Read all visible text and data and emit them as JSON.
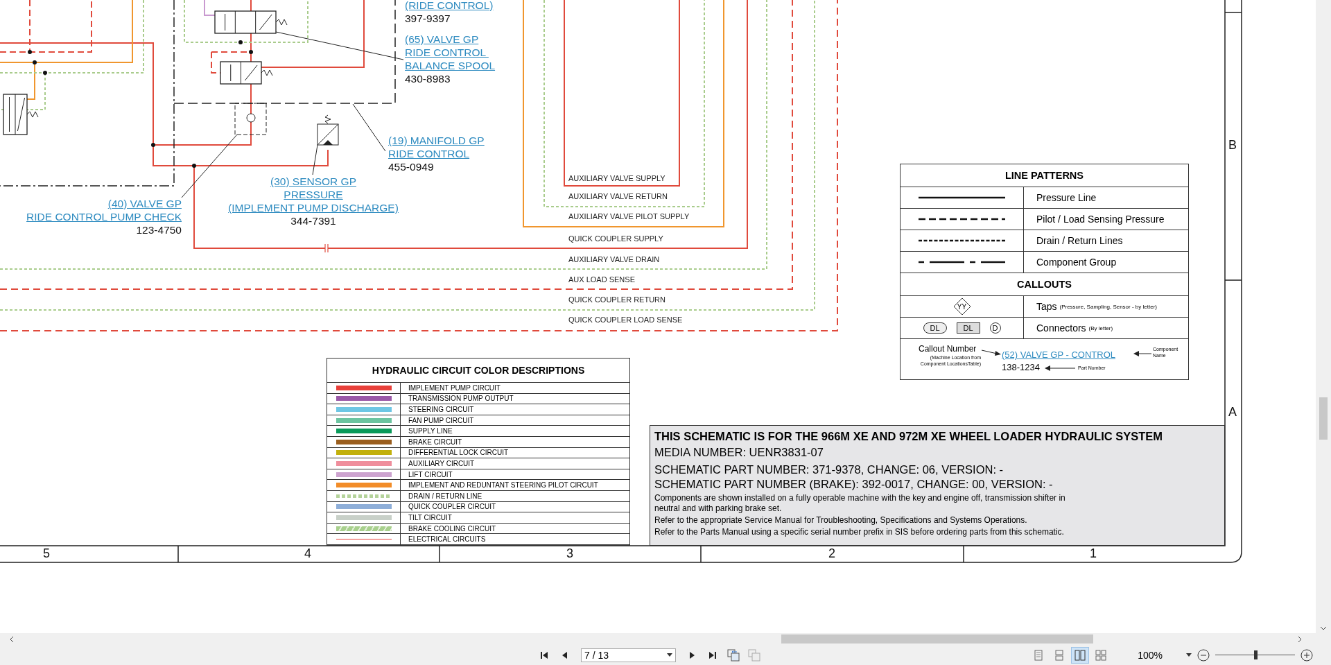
{
  "schematic": {
    "callouts": [
      {
        "name_lines": [
          "(RIDE CONTROL)"
        ],
        "part_number": "397-9397"
      },
      {
        "name_lines": [
          "(65) VALVE GP",
          "RIDE CONTROL ",
          "BALANCE SPOOL"
        ],
        "part_number": "430-8983"
      },
      {
        "name_lines": [
          "(19) MANIFOLD GP",
          "RIDE CONTROL"
        ],
        "part_number": "455-0949"
      },
      {
        "name_lines": [
          "(30) SENSOR GP",
          "PRESSURE",
          "(IMPLEMENT PUMP DISCHARGE)"
        ],
        "part_number": "344-7391"
      },
      {
        "name_lines": [
          "(40) VALVE GP",
          "RIDE CONTROL PUMP CHECK"
        ],
        "part_number": "123-4750"
      }
    ],
    "line_labels": [
      "AUXILIARY VALVE SUPPLY",
      "AUXILIARY VALVE RETURN",
      "AUXILIARY VALVE PILOT SUPPLY",
      "QUICK COUPLER SUPPLY",
      "AUXILIARY VALVE DRAIN",
      "AUX LOAD SENSE",
      "QUICK COUPLER RETURN",
      "QUICK COUPLER LOAD SENSE"
    ],
    "column_markers": [
      "5",
      "4",
      "3",
      "2",
      "1"
    ],
    "row_markers": [
      "B",
      "A"
    ]
  },
  "line_patterns": {
    "title": "LINE PATTERNS",
    "rows": [
      {
        "kind": "solid",
        "label": "Pressure Line"
      },
      {
        "kind": "dashed",
        "label": "Pilot / Load Sensing Pressure"
      },
      {
        "kind": "dotted",
        "label": "Drain / Return Lines"
      },
      {
        "kind": "dashdot",
        "label": "Component Group"
      }
    ],
    "callouts_title": "CALLOUTS",
    "taps": {
      "symbol": "YY",
      "label": "Taps",
      "note": "(Pressure, Sampling, Sensor - by letter)"
    },
    "connectors": {
      "symbols": [
        {
          "kind": "oval",
          "text": "DL"
        },
        {
          "kind": "square",
          "text": "DL"
        },
        {
          "kind": "circle",
          "text": "D"
        }
      ],
      "label": "Connectors",
      "note": "(By letter)"
    },
    "example": {
      "callout_number": "Callout Number",
      "callout_note": "(Machine Location from Component LocationsTable)",
      "link": "(52) VALVE GP - CONTROL",
      "part": "138-1234",
      "component_name": "Component Name",
      "part_label": "Part Number"
    }
  },
  "color_descriptions": {
    "title": "HYDRAULIC CIRCUIT COLOR DESCRIPTIONS",
    "items": [
      {
        "kind": "solid",
        "color": "#e8403a",
        "label": "IMPLEMENT PUMP CIRCUIT"
      },
      {
        "kind": "solid",
        "color": "#9b59a8",
        "label": "TRANSMISSION PUMP OUTPUT"
      },
      {
        "kind": "solid",
        "color": "#6ec6e4",
        "label": "STEERING CIRCUIT"
      },
      {
        "kind": "solid",
        "color": "#6cc4a0",
        "label": "FAN PUMP CIRCUIT"
      },
      {
        "kind": "solid",
        "color": "#0a9a5a",
        "label": "SUPPLY LINE"
      },
      {
        "kind": "solid",
        "color": "#9a5e1e",
        "label": "BRAKE CIRCUIT"
      },
      {
        "kind": "solid",
        "color": "#c2b00c",
        "label": "DIFFERENTIAL LOCK CIRCUIT"
      },
      {
        "kind": "solid",
        "color": "#ef8e9c",
        "label": "AUXILIARY CIRCUIT"
      },
      {
        "kind": "solid",
        "color": "#cda3cf",
        "label": "LIFT CIRCUIT"
      },
      {
        "kind": "solid",
        "color": "#f28c28",
        "label": "IMPLEMENT AND REDUNTANT STEERING PILOT CIRCUIT"
      },
      {
        "kind": "dotted",
        "color": "#b5d39b",
        "label": "DRAIN / RETURN LINE"
      },
      {
        "kind": "solid",
        "color": "#8eaed8",
        "label": "QUICK COUPLER CIRCUIT"
      },
      {
        "kind": "solid",
        "color": "#c8d0c8",
        "label": "TILT CIRCUIT"
      },
      {
        "kind": "hatched",
        "color": "#a8d08d",
        "label": "BRAKE COOLING CIRCUIT"
      },
      {
        "kind": "thin",
        "color": "#e8403a",
        "label": "ELECTRICAL CIRCUITS"
      }
    ]
  },
  "title_block": {
    "heading": "THIS SCHEMATIC IS FOR THE 966M XE AND 972M XE WHEEL LOADER HYDRAULIC SYSTEM",
    "large_lines": [
      "MEDIA NUMBER: UENR3831-07",
      "SCHEMATIC PART NUMBER: 371-9378, CHANGE: 06, VERSION: -",
      "SCHEMATIC PART NUMBER (BRAKE): 392-0017, CHANGE: 00, VERSION: -"
    ],
    "notes": [
      "Components are shown installed on a fully operable machine with the key and engine off, transmission shifter in neutral and with parking brake set.",
      "Refer to the appropriate Service Manual for Troubleshooting, Specifications and Systems Operations.",
      "Refer to the Parts Manual using a specific serial number prefix in SIS before ordering parts from this schematic."
    ]
  },
  "viewer": {
    "page_field": "7 / 13",
    "zoom_value": "100%",
    "zoom_slider": {
      "level": 0.5
    },
    "view_modes": [
      {
        "kind": "single",
        "selected": false
      },
      {
        "kind": "continuous",
        "selected": false
      },
      {
        "kind": "facing",
        "selected": true
      },
      {
        "kind": "cover",
        "selected": false
      }
    ]
  }
}
